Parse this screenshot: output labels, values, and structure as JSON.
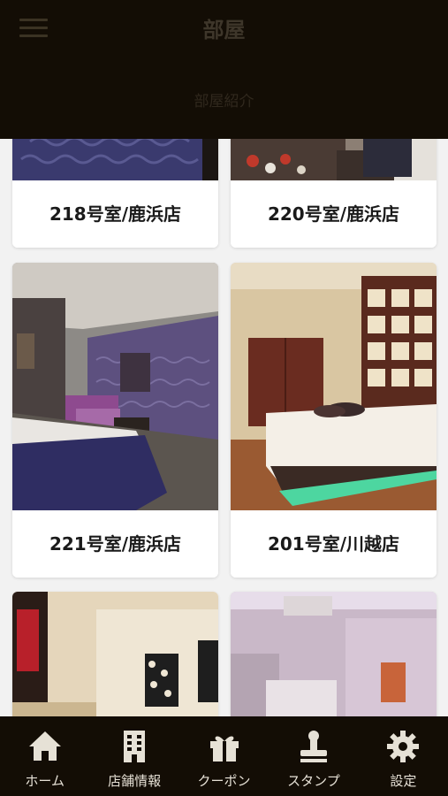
{
  "header": {
    "title": "部屋",
    "subtitle": "部屋紹介"
  },
  "rooms": [
    {
      "label": "218号室/鹿浜店"
    },
    {
      "label": "220号室/鹿浜店"
    },
    {
      "label": "221号室/鹿浜店"
    },
    {
      "label": "201号室/川越店"
    }
  ],
  "tabs": [
    {
      "label": "ホーム",
      "icon": "home-icon"
    },
    {
      "label": "店舗情報",
      "icon": "building-icon"
    },
    {
      "label": "クーポン",
      "icon": "gift-icon"
    },
    {
      "label": "スタンプ",
      "icon": "stamp-icon"
    },
    {
      "label": "設定",
      "icon": "gear-icon"
    }
  ],
  "colors": {
    "header_bg": "#130d05",
    "tabbar_bg": "#130d05",
    "tab_icon": "#e6e1d6",
    "card_bg": "#ffffff"
  }
}
